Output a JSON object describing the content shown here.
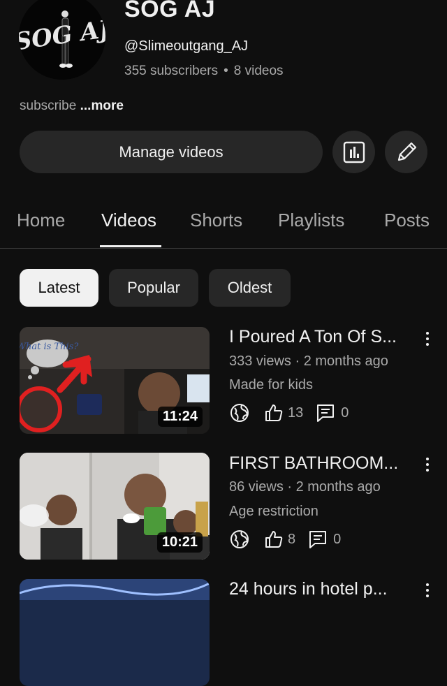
{
  "channel": {
    "avatar_text": "SOG AJ",
    "name": "SOG AJ",
    "handle": "@Slimeoutgang_AJ",
    "subscribers": "355 subscribers",
    "separator": "•",
    "video_count": "8 videos",
    "description": "subscribe",
    "more_label": "...more"
  },
  "actions": {
    "manage_videos_label": "Manage videos",
    "analytics_icon": "analytics-icon",
    "edit_icon": "pencil-icon"
  },
  "tabs": [
    {
      "label": "Home",
      "active": false
    },
    {
      "label": "Videos",
      "active": true
    },
    {
      "label": "Shorts",
      "active": false
    },
    {
      "label": "Playlists",
      "active": false
    },
    {
      "label": "Posts",
      "active": false
    }
  ],
  "chips": [
    {
      "label": "Latest",
      "selected": true
    },
    {
      "label": "Popular",
      "selected": false
    },
    {
      "label": "Oldest",
      "selected": false
    }
  ],
  "videos": [
    {
      "title": "I Poured A Ton Of S...",
      "meta": "333 views · 2 months ago",
      "tag": "Made for kids",
      "likes": "13",
      "comments": "0",
      "duration": "11:24",
      "thumb_text": "What is This?"
    },
    {
      "title": "FIRST BATHROOM...",
      "meta": "86 views · 2 months ago",
      "tag": "Age restriction",
      "likes": "8",
      "comments": "0",
      "duration": "10:21"
    },
    {
      "title": "24 hours in hotel p..."
    }
  ],
  "colors": {
    "background": "#0f0f0f",
    "surface": "#272727",
    "text_primary": "#f1f1f1",
    "text_secondary": "#aaaaaa",
    "accent_red": "#e02020"
  }
}
